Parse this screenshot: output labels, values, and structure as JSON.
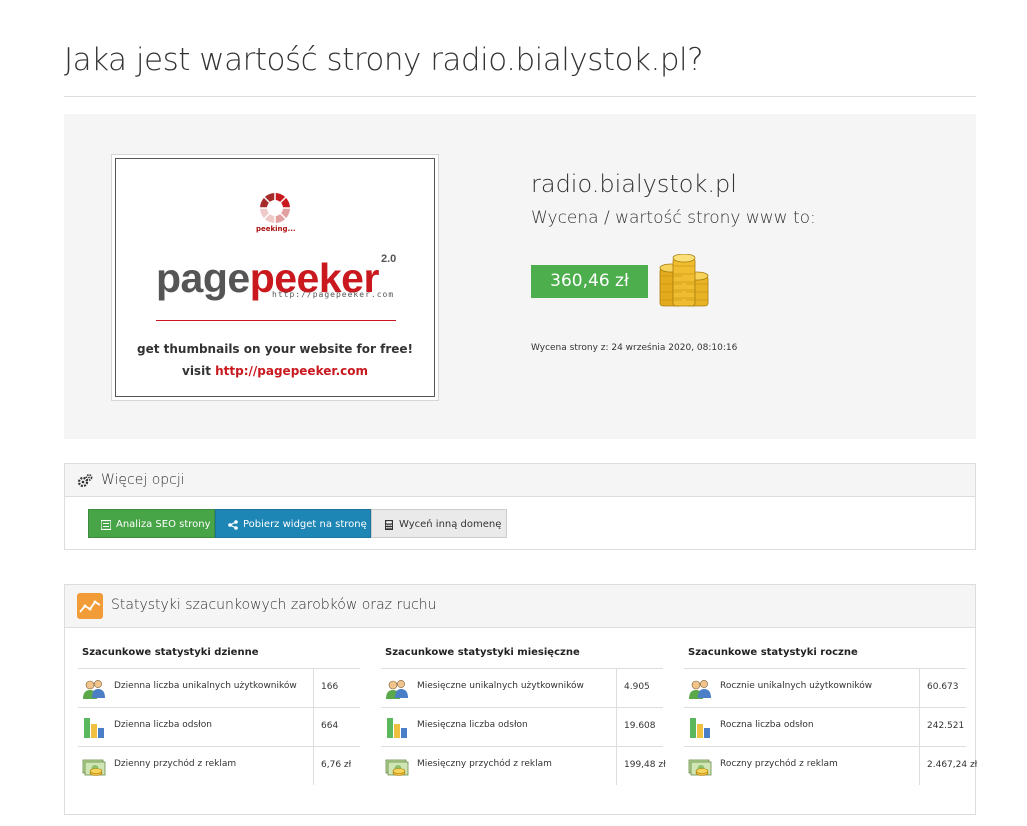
{
  "page": {
    "title": "Jaka jest wartość strony radio.bialystok.pl?"
  },
  "hero": {
    "thumbnail": {
      "status": "peeking...",
      "logo_part1": "page",
      "logo_part2": "peeker",
      "logo_version": "2.0",
      "logo_url": "http://pagepeeker.com",
      "promo_line1": "get thumbnails on your website for free!",
      "promo_line2_prefix": "visit ",
      "promo_line2_link": "http://pagepeeker.com"
    },
    "domain": "radio.bialystok.pl",
    "value_label": "Wycena / wartość strony www to:",
    "value": "360,46 zł",
    "valued_at": "Wycena strony z: 24 września 2020, 08:10:16"
  },
  "options": {
    "header": "Więcej opcji",
    "buttons": {
      "seo": "Analiza SEO strony",
      "widget": "Pobierz widget na stronę",
      "other": "Wyceń inną domenę"
    }
  },
  "stats": {
    "header": "Statystyki szacunkowych zarobków oraz ruchu",
    "columns": [
      {
        "title": "Szacunkowe statystyki dzienne",
        "rows": [
          {
            "icon": "users-icon",
            "label": "Dzienna liczba unikalnych użytkowników",
            "value": "166"
          },
          {
            "icon": "bar-chart-icon",
            "label": "Dzienna liczba odsłon",
            "value": "664"
          },
          {
            "icon": "money-icon",
            "label": "Dzienny przychód z reklam",
            "value": "6,76 zł"
          }
        ]
      },
      {
        "title": "Szacunkowe statystyki miesięczne",
        "rows": [
          {
            "icon": "users-icon",
            "label": "Miesięczne unikalnych użytkowników",
            "value": "4.905"
          },
          {
            "icon": "bar-chart-icon",
            "label": "Miesięczna liczba odsłon",
            "value": "19.608"
          },
          {
            "icon": "money-icon",
            "label": "Miesięczny przychód z reklam",
            "value": "199,48 zł"
          }
        ]
      },
      {
        "title": "Szacunkowe statystyki roczne",
        "rows": [
          {
            "icon": "users-icon",
            "label": "Rocznie unikalnych użytkowników",
            "value": "60.673"
          },
          {
            "icon": "bar-chart-icon",
            "label": "Roczna liczba odsłon",
            "value": "242.521"
          },
          {
            "icon": "money-icon",
            "label": "Roczny przychód z reklam",
            "value": "2.467,24 zł"
          }
        ]
      }
    ]
  },
  "colors": {
    "success_green": "#4cae4c",
    "info_blue": "#1e86b5",
    "brand_red": "#c9181e"
  }
}
